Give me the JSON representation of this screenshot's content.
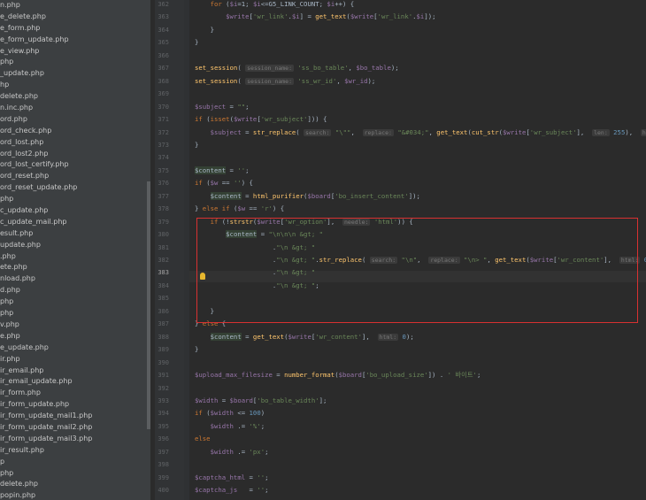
{
  "sidebar": {
    "files": [
      "n.php",
      "e_delete.php",
      "e_form.php",
      "e_form_update.php",
      "e_view.php",
      "php",
      "_update.php",
      "hp",
      "delete.php",
      "n.inc.php",
      "ord.php",
      "ord_check.php",
      "ord_lost.php",
      "ord_lost2.php",
      "ord_lost_certify.php",
      "ord_reset.php",
      "ord_reset_update.php",
      "php",
      "c_update.php",
      "c_update_mail.php",
      "esult.php",
      "update.php",
      ".php",
      "ete.php",
      "nload.php",
      "d.php",
      "php",
      "php",
      "v.php",
      "e.php",
      "e_update.php",
      "ir.php",
      "ir_email.php",
      "ir_email_update.php",
      "ir_form.php",
      "ir_form_update.php",
      "ir_form_update_mail1.php",
      "ir_form_update_mail2.php",
      "ir_form_update_mail3.php",
      "ir_result.php",
      "p",
      "php",
      "delete.php",
      "popin.php"
    ]
  },
  "editor": {
    "line_numbers": [
      "362",
      "363",
      "364",
      "365",
      "366",
      "367",
      "368",
      "369",
      "370",
      "371",
      "372",
      "373",
      "374",
      "375",
      "376",
      "377",
      "378",
      "379",
      "380",
      "381",
      "382",
      "383",
      "384",
      "385",
      "386",
      "387",
      "388",
      "389",
      "390",
      "391",
      "392",
      "393",
      "394",
      "395",
      "396",
      "397",
      "398",
      "399",
      "400"
    ],
    "current_line": "383",
    "lines": [
      [
        {
          "t": "    "
        },
        {
          "t": "for",
          "c": "kw"
        },
        {
          "t": " ("
        },
        {
          "t": "$i",
          "c": "var"
        },
        {
          "t": "=1; "
        },
        {
          "t": "$i",
          "c": "var"
        },
        {
          "t": "<=G5_LINK_COUNT; "
        },
        {
          "t": "$i",
          "c": "var"
        },
        {
          "t": "++) {"
        }
      ],
      [
        {
          "t": "        "
        },
        {
          "t": "$write",
          "c": "var"
        },
        {
          "t": "["
        },
        {
          "t": "'wr_link'",
          "c": "str"
        },
        {
          "t": "."
        },
        {
          "t": "$i",
          "c": "var"
        },
        {
          "t": "] = "
        },
        {
          "t": "get_text",
          "c": "fn"
        },
        {
          "t": "("
        },
        {
          "t": "$write",
          "c": "var"
        },
        {
          "t": "["
        },
        {
          "t": "'wr_link'",
          "c": "str"
        },
        {
          "t": "."
        },
        {
          "t": "$i",
          "c": "var"
        },
        {
          "t": "]);"
        }
      ],
      [
        {
          "t": "    }"
        }
      ],
      [
        {
          "t": "}"
        }
      ],
      [
        {
          "t": ""
        }
      ],
      [
        {
          "t": "set_session",
          "c": "fn"
        },
        {
          "t": "( "
        },
        {
          "t": "session_name:",
          "c": "hint"
        },
        {
          "t": " "
        },
        {
          "t": "'ss_bo_table'",
          "c": "str"
        },
        {
          "t": ", "
        },
        {
          "t": "$bo_table",
          "c": "var"
        },
        {
          "t": ");"
        }
      ],
      [
        {
          "t": "set_session",
          "c": "fn"
        },
        {
          "t": "( "
        },
        {
          "t": "session_name:",
          "c": "hint"
        },
        {
          "t": " "
        },
        {
          "t": "'ss_wr_id'",
          "c": "str"
        },
        {
          "t": ", "
        },
        {
          "t": "$wr_id",
          "c": "var"
        },
        {
          "t": ");"
        }
      ],
      [
        {
          "t": ""
        }
      ],
      [
        {
          "t": "$subject",
          "c": "var"
        },
        {
          "t": " = "
        },
        {
          "t": "\"\"",
          "c": "str"
        },
        {
          "t": ";"
        }
      ],
      [
        {
          "t": "if",
          "c": "kw"
        },
        {
          "t": " ("
        },
        {
          "t": "isset",
          "c": "kw"
        },
        {
          "t": "("
        },
        {
          "t": "$write",
          "c": "var"
        },
        {
          "t": "["
        },
        {
          "t": "'wr_subject'",
          "c": "str"
        },
        {
          "t": "])) {"
        }
      ],
      [
        {
          "t": "    "
        },
        {
          "t": "$subject",
          "c": "var"
        },
        {
          "t": " = "
        },
        {
          "t": "str_replace",
          "c": "fn"
        },
        {
          "t": "( "
        },
        {
          "t": "search:",
          "c": "hint"
        },
        {
          "t": " "
        },
        {
          "t": "\"\\\"\"",
          "c": "str"
        },
        {
          "t": ",  "
        },
        {
          "t": "replace:",
          "c": "hint"
        },
        {
          "t": " "
        },
        {
          "t": "\"&#034;\"",
          "c": "str"
        },
        {
          "t": ", "
        },
        {
          "t": "get_text",
          "c": "fn"
        },
        {
          "t": "("
        },
        {
          "t": "cut_str",
          "c": "fn"
        },
        {
          "t": "("
        },
        {
          "t": "$write",
          "c": "var"
        },
        {
          "t": "["
        },
        {
          "t": "'wr_subject'",
          "c": "str"
        },
        {
          "t": "],  "
        },
        {
          "t": "len:",
          "c": "hint"
        },
        {
          "t": " "
        },
        {
          "t": "255",
          "c": "num"
        },
        {
          "t": "),  "
        },
        {
          "t": "htm",
          "c": "hint"
        }
      ],
      [
        {
          "t": "}"
        }
      ],
      [
        {
          "t": ""
        }
      ],
      [
        {
          "t": "$content",
          "c": "var hl"
        },
        {
          "t": " = "
        },
        {
          "t": "''",
          "c": "str"
        },
        {
          "t": ";"
        }
      ],
      [
        {
          "t": "if",
          "c": "kw"
        },
        {
          "t": " ("
        },
        {
          "t": "$w",
          "c": "var"
        },
        {
          "t": " == "
        },
        {
          "t": "''",
          "c": "str"
        },
        {
          "t": ") {"
        }
      ],
      [
        {
          "t": "    "
        },
        {
          "t": "$content",
          "c": "var hl"
        },
        {
          "t": " = "
        },
        {
          "t": "html_purifier",
          "c": "fn"
        },
        {
          "t": "("
        },
        {
          "t": "$board",
          "c": "var"
        },
        {
          "t": "["
        },
        {
          "t": "'bo_insert_content'",
          "c": "str"
        },
        {
          "t": "]);"
        }
      ],
      [
        {
          "t": "} "
        },
        {
          "t": "else if",
          "c": "kw"
        },
        {
          "t": " ("
        },
        {
          "t": "$w",
          "c": "var"
        },
        {
          "t": " == "
        },
        {
          "t": "'r'",
          "c": "str"
        },
        {
          "t": ") {"
        }
      ],
      [
        {
          "t": "    "
        },
        {
          "t": "if",
          "c": "kw"
        },
        {
          "t": " (!"
        },
        {
          "t": "strstr",
          "c": "fn"
        },
        {
          "t": "("
        },
        {
          "t": "$write",
          "c": "var"
        },
        {
          "t": "["
        },
        {
          "t": "'wr_option'",
          "c": "str"
        },
        {
          "t": "],  "
        },
        {
          "t": "needle:",
          "c": "hint"
        },
        {
          "t": " "
        },
        {
          "t": "'html'",
          "c": "str"
        },
        {
          "t": ")) {"
        }
      ],
      [
        {
          "t": "        "
        },
        {
          "t": "$content",
          "c": "var hl"
        },
        {
          "t": " = "
        },
        {
          "t": "\"\\n\\n\\n &gt; \"",
          "c": "str"
        }
      ],
      [
        {
          "t": "                    ."
        },
        {
          "t": "\"\\n &gt; \"",
          "c": "str"
        }
      ],
      [
        {
          "t": "                    ."
        },
        {
          "t": "\"\\n &gt; \"",
          "c": "str"
        },
        {
          "t": "."
        },
        {
          "t": "str_replace",
          "c": "fn"
        },
        {
          "t": "( "
        },
        {
          "t": "search:",
          "c": "hint"
        },
        {
          "t": " "
        },
        {
          "t": "\"\\n\"",
          "c": "str"
        },
        {
          "t": ",  "
        },
        {
          "t": "replace:",
          "c": "hint"
        },
        {
          "t": " "
        },
        {
          "t": "\"\\n> \"",
          "c": "str"
        },
        {
          "t": ", "
        },
        {
          "t": "get_text",
          "c": "fn"
        },
        {
          "t": "("
        },
        {
          "t": "$write",
          "c": "var"
        },
        {
          "t": "["
        },
        {
          "t": "'wr_content'",
          "c": "str"
        },
        {
          "t": "],  "
        },
        {
          "t": "html:",
          "c": "hint"
        },
        {
          "t": " "
        },
        {
          "t": "0",
          "c": "num"
        },
        {
          "t": "))"
        }
      ],
      [
        {
          "t": "                    ."
        },
        {
          "t": "\"\\n &gt; \"",
          "c": "str"
        }
      ],
      [
        {
          "t": "                    ."
        },
        {
          "t": "\"\\n &gt; \"",
          "c": "str"
        },
        {
          "t": ";"
        }
      ],
      [
        {
          "t": ""
        }
      ],
      [
        {
          "t": "    }"
        }
      ],
      [
        {
          "t": "} "
        },
        {
          "t": "else",
          "c": "kw"
        },
        {
          "t": " {"
        }
      ],
      [
        {
          "t": "    "
        },
        {
          "t": "$content",
          "c": "var hl"
        },
        {
          "t": " = "
        },
        {
          "t": "get_text",
          "c": "fn"
        },
        {
          "t": "("
        },
        {
          "t": "$write",
          "c": "var"
        },
        {
          "t": "["
        },
        {
          "t": "'wr_content'",
          "c": "str"
        },
        {
          "t": "],  "
        },
        {
          "t": "html:",
          "c": "hint"
        },
        {
          "t": " "
        },
        {
          "t": "0",
          "c": "num"
        },
        {
          "t": ");"
        }
      ],
      [
        {
          "t": "}"
        }
      ],
      [
        {
          "t": ""
        }
      ],
      [
        {
          "t": "$upload_max_filesize",
          "c": "var"
        },
        {
          "t": " = "
        },
        {
          "t": "number_format",
          "c": "fn"
        },
        {
          "t": "("
        },
        {
          "t": "$board",
          "c": "var"
        },
        {
          "t": "["
        },
        {
          "t": "'bo_upload_size'",
          "c": "str"
        },
        {
          "t": "]) . "
        },
        {
          "t": "' 바이트'",
          "c": "str"
        },
        {
          "t": ";"
        }
      ],
      [
        {
          "t": ""
        }
      ],
      [
        {
          "t": "$width",
          "c": "var"
        },
        {
          "t": " = "
        },
        {
          "t": "$board",
          "c": "var"
        },
        {
          "t": "["
        },
        {
          "t": "'bo_table_width'",
          "c": "str"
        },
        {
          "t": "];"
        }
      ],
      [
        {
          "t": "if",
          "c": "kw"
        },
        {
          "t": " ("
        },
        {
          "t": "$width",
          "c": "var"
        },
        {
          "t": " <= "
        },
        {
          "t": "100",
          "c": "num"
        },
        {
          "t": ")"
        }
      ],
      [
        {
          "t": "    "
        },
        {
          "t": "$width",
          "c": "var"
        },
        {
          "t": " .= "
        },
        {
          "t": "'%'",
          "c": "str"
        },
        {
          "t": ";"
        }
      ],
      [
        {
          "t": "else",
          "c": "kw"
        }
      ],
      [
        {
          "t": "    "
        },
        {
          "t": "$width",
          "c": "var"
        },
        {
          "t": " .= "
        },
        {
          "t": "'px'",
          "c": "str"
        },
        {
          "t": ";"
        }
      ],
      [
        {
          "t": ""
        }
      ],
      [
        {
          "t": "$captcha_html",
          "c": "var"
        },
        {
          "t": " = "
        },
        {
          "t": "''",
          "c": "str"
        },
        {
          "t": ";"
        }
      ],
      [
        {
          "t": "$captcha_js",
          "c": "var"
        },
        {
          "t": "   = "
        },
        {
          "t": "''",
          "c": "str"
        },
        {
          "t": ";"
        }
      ]
    ]
  },
  "colors": {
    "background": "#2b2b2b",
    "sidebar": "#3c3f41",
    "keyword": "#cc7832",
    "variable": "#9876aa",
    "string": "#6a8759",
    "function": "#ffc66d",
    "number": "#6897bb",
    "selection_box": "#d83131"
  },
  "icons": {
    "intention_bulb": "lightbulb-icon"
  }
}
